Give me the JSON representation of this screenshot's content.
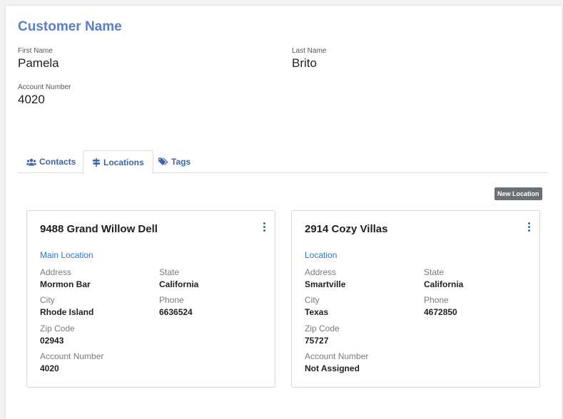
{
  "customer": {
    "title": "Customer Name",
    "first_name_label": "First Name",
    "first_name": "Pamela",
    "last_name_label": "Last Name",
    "last_name": "Brito",
    "account_number_label": "Account Number",
    "account_number": "4020"
  },
  "tabs": [
    {
      "label": "Contacts",
      "icon": "users-icon",
      "active": false
    },
    {
      "label": "Locations",
      "icon": "signpost-icon",
      "active": true
    },
    {
      "label": "Tags",
      "icon": "tags-icon",
      "active": false
    }
  ],
  "new_location_label": "New Location",
  "locations": [
    {
      "name": "9488 Grand Willow Dell",
      "type": "Main Location",
      "address_label": "Address",
      "address": "Mormon Bar",
      "state_label": "State",
      "state": "California",
      "city_label": "City",
      "city": "Rhode Island",
      "phone_label": "Phone",
      "phone": "6636524",
      "zip_label": "Zip Code",
      "zip": "02943",
      "account_label": "Account Number",
      "account": "4020"
    },
    {
      "name": "2914 Cozy Villas",
      "type": "Location",
      "address_label": "Address",
      "address": "Smartville",
      "state_label": "State",
      "state": "California",
      "city_label": "City",
      "city": "Texas",
      "phone_label": "Phone",
      "phone": "4672850",
      "zip_label": "Zip Code",
      "zip": "75727",
      "account_label": "Account Number",
      "account": "Not Assigned"
    }
  ],
  "colors": {
    "title": "#5b7fc4",
    "tab_text": "#3d63a8",
    "location_type": "#2f74d0",
    "new_button_bg": "#6c6f73"
  }
}
